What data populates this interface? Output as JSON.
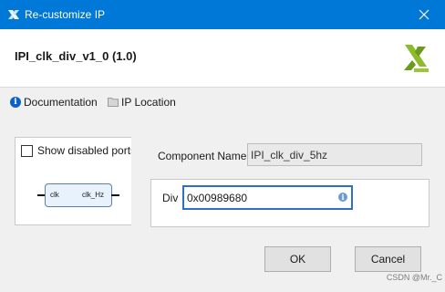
{
  "window": {
    "title": "Re-customize IP",
    "close_icon": "close-icon"
  },
  "header": {
    "ip_name": "IPI_clk_div_v1_0 (1.0)",
    "logo_icon": "brand-logo"
  },
  "toolbar": {
    "documentation_label": "Documentation",
    "ip_location_label": "IP Location"
  },
  "symbol_panel": {
    "show_disabled_ports_label": "Show disabled ports",
    "show_disabled_ports_checked": false,
    "input_port": "clk",
    "output_port": "clk_Hz"
  },
  "params": {
    "component_name_label": "Component Name",
    "component_name_value": "IPI_clk_div_5hz",
    "div_label": "Div",
    "div_value": "0x00989680"
  },
  "buttons": {
    "ok_label": "OK",
    "cancel_label": "Cancel"
  },
  "watermark": "CSDN @Mr._C",
  "colors": {
    "titlebar": "#0078d7",
    "logo_green": "#6a9b1f",
    "focus_border": "#2f6fc9"
  }
}
